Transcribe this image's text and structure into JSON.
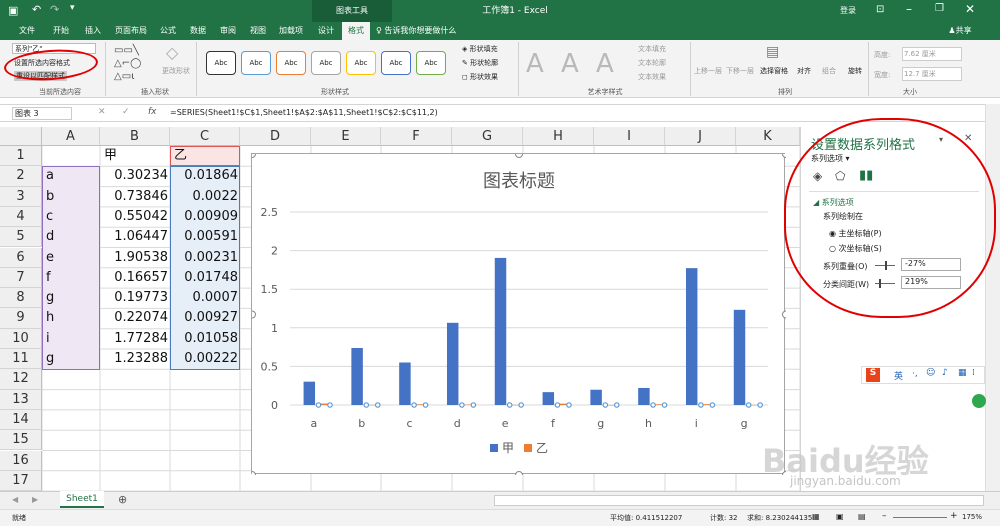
{
  "titlebar": {
    "title": "工作簿1 - Excel",
    "context_tool": "图表工具",
    "login": "登录"
  },
  "tabs": [
    {
      "label": "文件"
    },
    {
      "label": "开始"
    },
    {
      "label": "插入"
    },
    {
      "label": "页面布局"
    },
    {
      "label": "公式"
    },
    {
      "label": "数据"
    },
    {
      "label": "审阅"
    },
    {
      "label": "视图"
    },
    {
      "label": "加载项"
    },
    {
      "label": "设计"
    },
    {
      "label": "格式"
    }
  ],
  "tell_me": "告诉我你想要做什么",
  "share": "共享",
  "ribbon": {
    "series_dropdown": "系列\"乙\"",
    "format_selection": "设置所选内容格式",
    "reset_style": "重设以匹配样式",
    "group_current": "当前所选内容",
    "change_shape": "更改形状",
    "group_insert_shapes": "插入形状",
    "abc": "Abc",
    "shape_fill": "形状填充",
    "shape_outline": "形状轮廓",
    "shape_effects": "形状效果",
    "group_shape_styles": "形状样式",
    "text_fill": "文本填充",
    "text_outline": "文本轮廓",
    "text_effects": "文本效果",
    "group_wordart": "艺术字样式",
    "bring_forward": "上移一层",
    "send_backward": "下移一层",
    "selection_pane": "选择窗格",
    "align": "对齐",
    "group_btn": "组合",
    "rotate": "旋转",
    "group_arrange": "排列",
    "height_label": "高度:",
    "height_value": "7.62 厘米",
    "width_label": "宽度:",
    "width_value": "12.7 厘米",
    "group_size": "大小"
  },
  "formula_bar": {
    "name_box": "图表 3",
    "fx": "fx",
    "formula": "=SERIES(Sheet1!$C$1,Sheet1!$A$2:$A$11,Sheet1!$C$2:$C$11,2)"
  },
  "columns": [
    "A",
    "B",
    "C",
    "D",
    "E",
    "F",
    "G",
    "H",
    "I",
    "J",
    "K"
  ],
  "rows": [
    "1",
    "2",
    "3",
    "4",
    "5",
    "6",
    "7",
    "8",
    "9",
    "10",
    "11",
    "12",
    "13",
    "14",
    "15",
    "16",
    "17"
  ],
  "headers": {
    "b": "甲",
    "c": "乙"
  },
  "table": [
    {
      "a": "a",
      "b": "0.30234",
      "c": "0.01864"
    },
    {
      "a": "b",
      "b": "0.73846",
      "c": "0.0022"
    },
    {
      "a": "c",
      "b": "0.55042",
      "c": "0.00909"
    },
    {
      "a": "d",
      "b": "1.06447",
      "c": "0.00591"
    },
    {
      "a": "e",
      "b": "1.90538",
      "c": "0.00231"
    },
    {
      "a": "f",
      "b": "0.16657",
      "c": "0.01748"
    },
    {
      "a": "g",
      "b": "0.19773",
      "c": "0.0007"
    },
    {
      "a": "h",
      "b": "0.22074",
      "c": "0.00927"
    },
    {
      "a": "i",
      "b": "1.77284",
      "c": "0.01058"
    },
    {
      "a": "g",
      "b": "1.23288",
      "c": "0.00222"
    }
  ],
  "chart_data": {
    "type": "bar",
    "title": "图表标题",
    "categories": [
      "a",
      "b",
      "c",
      "d",
      "e",
      "f",
      "g",
      "h",
      "i",
      "g"
    ],
    "series": [
      {
        "name": "甲",
        "color": "#4472c4",
        "values": [
          0.30234,
          0.73846,
          0.55042,
          1.06447,
          1.90538,
          0.16657,
          0.19773,
          0.22074,
          1.77284,
          1.23288
        ]
      },
      {
        "name": "乙",
        "color": "#ed7d31",
        "values": [
          0.01864,
          0.0022,
          0.00909,
          0.00591,
          0.00231,
          0.01748,
          0.0007,
          0.00927,
          0.01058,
          0.00222
        ]
      }
    ],
    "yticks": [
      "0",
      "0.5",
      "1",
      "1.5",
      "2",
      "2.5"
    ],
    "ylim": [
      0,
      2.5
    ],
    "legend": "bottom",
    "grid": true
  },
  "pane": {
    "title": "设置数据系列格式",
    "series_options_dropdown": "系列选项",
    "section": "系列选项",
    "plot_on": "系列绘制在",
    "primary_axis": "主坐标轴(P)",
    "secondary_axis": "次坐标轴(S)",
    "overlap_label": "系列重叠(O)",
    "overlap_value": "-27%",
    "gap_label": "分类间距(W)",
    "gap_value": "219%"
  },
  "ime": {
    "label": "英"
  },
  "sheet_tab": "Sheet1",
  "status": {
    "ready": "就绪",
    "average": "平均值: 0.411512207",
    "count": "计数: 32",
    "sum": "求和: 8.230244135",
    "zoom": "175%"
  },
  "watermark": {
    "line1": "Baidu经验",
    "line2": "jingyan.baidu.com"
  }
}
